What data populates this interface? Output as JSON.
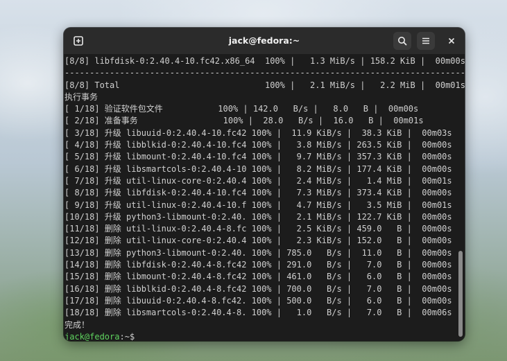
{
  "window": {
    "title": "jack@fedora:~"
  },
  "icons": {
    "new_tab": "new-tab-icon",
    "search": "search-icon",
    "menu": "hamburger-menu-icon",
    "close": "close-icon"
  },
  "terminal": {
    "lines": [
      "[8/8] libfdisk-0:2.40.4-10.fc42.x86_64  100% |   1.3 MiB/s | 158.2 KiB |  00m00s",
      "------------------------------------------------------------------------------------",
      "[8/8] Total                             100% |   2.1 MiB/s |   2.2 MiB |  00m01s",
      "执行事务",
      "[ 1/18] 验证软件包文件           100% | 142.0   B/s |   8.0   B |  00m00s",
      "[ 2/18] 准备事务                 100% |  28.0   B/s |  16.0   B |  00m01s",
      "[ 3/18] 升级 libuuid-0:2.40.4-10.fc42 100% |  11.9 KiB/s |  38.3 KiB |  00m03s",
      "[ 4/18] 升级 libblkid-0:2.40.4-10.fc4 100% |   3.8 MiB/s | 263.5 KiB |  00m00s",
      "[ 5/18] 升级 libmount-0:2.40.4-10.fc4 100% |   9.7 MiB/s | 357.3 KiB |  00m00s",
      "[ 6/18] 升级 libsmartcols-0:2.40.4-10 100% |   8.2 MiB/s | 177.4 KiB |  00m00s",
      "[ 7/18] 升级 util-linux-core-0:2.40.4 100% |   2.4 MiB/s |   1.4 MiB |  00m01s",
      "[ 8/18] 升级 libfdisk-0:2.40.4-10.fc4 100% |   7.3 MiB/s | 373.4 KiB |  00m00s",
      "[ 9/18] 升级 util-linux-0:2.40.4-10.f 100% |   4.7 MiB/s |   3.5 MiB |  00m01s",
      "[10/18] 升级 python3-libmount-0:2.40. 100% |   2.1 MiB/s | 122.7 KiB |  00m00s",
      "[11/18] 删除 util-linux-0:2.40.4-8.fc 100% |   2.5 KiB/s | 459.0   B |  00m00s",
      "[12/18] 删除 util-linux-core-0:2.40.4 100% |   2.3 KiB/s | 152.0   B |  00m00s",
      "[13/18] 删除 python3-libmount-0:2.40. 100% | 785.0   B/s |  11.0   B |  00m00s",
      "[14/18] 删除 libfdisk-0:2.40.4-8.fc42 100% | 291.0   B/s |   7.0   B |  00m00s",
      "[15/18] 删除 libmount-0:2.40.4-8.fc42 100% | 461.0   B/s |   6.0   B |  00m00s",
      "[16/18] 删除 libblkid-0:2.40.4-8.fc42 100% | 700.0   B/s |   7.0   B |  00m00s",
      "[17/18] 删除 libuuid-0:2.40.4-8.fc42. 100% | 500.0   B/s |   6.0   B |  00m00s",
      "[18/18] 删除 libsmartcols-0:2.40.4-8. 100% |   1.0   B/s |   7.0   B |  00m06s",
      "完成！"
    ],
    "prompt": {
      "user_host": "jack@fedora",
      "sep": ":",
      "path": "~",
      "symbol": "$"
    }
  },
  "colors": {
    "prompt_green": "#5fd35f",
    "terminal_bg": "#1c1c1c",
    "text": "#d0d0d0"
  }
}
